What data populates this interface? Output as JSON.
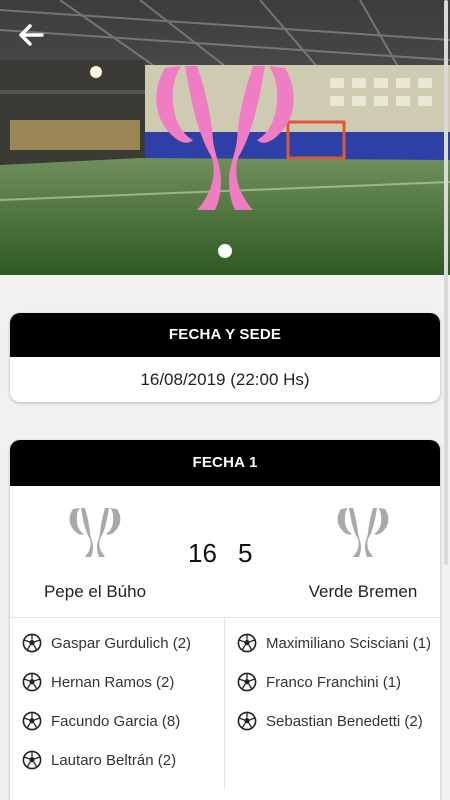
{
  "hero": {
    "back_icon": "arrow-left-icon",
    "logo_icon": "trophy-logo-icon",
    "colors": {
      "logo": "#f07cc4",
      "field": "#3d6b2b"
    }
  },
  "date_card": {
    "title": "FECHA Y SEDE",
    "value": "16/08/2019 (22:00 Hs)"
  },
  "match_card": {
    "title": "FECHA 1",
    "home": {
      "name": "Pepe el Búho",
      "score": "16"
    },
    "away": {
      "name": "Verde Bremen",
      "score": "5"
    },
    "home_scorers": [
      "Gaspar Gurdulich (2)",
      "Hernan Ramos (2)",
      "Facundo Garcia (8)",
      "Lautaro Beltrán (2)"
    ],
    "away_scorers": [
      "Maximiliano Scisciani (1)",
      "Franco Franchini (1)",
      "Sebastian Benedetti (2)"
    ],
    "scorer_icon": "soccer-ball-icon"
  }
}
